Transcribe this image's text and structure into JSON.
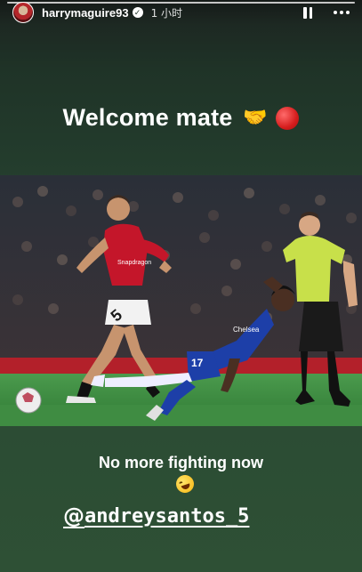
{
  "story": {
    "progress": 1.0,
    "header": {
      "username": "harrymaguire93",
      "verified_icon": "verified-check-icon",
      "time": "1 小时",
      "pause_icon": "pause-icon",
      "more_icon": "more-dots-icon"
    },
    "headline": {
      "text": "Welcome mate",
      "emojis": [
        "handshake-emoji",
        "red-circle-emoji"
      ]
    },
    "photo": {
      "description_icon": "football-action-photo",
      "shirt_number_red": "5",
      "shirt_number_blue": "17"
    },
    "caption": {
      "text": "No more fighting now",
      "emoji": "rolling-on-floor-laughing-emoji"
    },
    "mention": {
      "icon": "threads-at-icon",
      "symbol": "@",
      "handle": "andreysantos_5"
    }
  },
  "colors": {
    "background_top": "#1c2320",
    "background_bottom": "#2e5035",
    "united_red": "#c4162a",
    "chelsea_blue": "#1d3fa8",
    "referee_yellow": "#c8e04a",
    "pitch_green": "#3c8a3e"
  }
}
